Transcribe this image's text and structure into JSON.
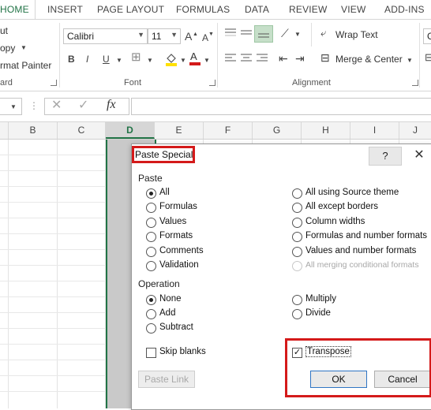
{
  "ribbon": {
    "tabs": [
      "HOME",
      "INSERT",
      "PAGE LAYOUT",
      "FORMULAS",
      "DATA",
      "REVIEW",
      "VIEW",
      "ADD-INS"
    ],
    "clipboard": {
      "cut": "ut",
      "copy": "opy",
      "format_painter": "rmat Painter",
      "label": "ard"
    },
    "font": {
      "name": "Calibri",
      "size": "11",
      "label": "Font",
      "grow": "A",
      "shrink": "A",
      "bold": "B",
      "italic": "I",
      "underline": "U"
    },
    "alignment": {
      "wrap_text": "Wrap Text",
      "merge_center": "Merge & Center",
      "label": "Alignment"
    },
    "number_format_partial": "G"
  },
  "formula_bar": {
    "fx": "fx",
    "cancel": "✕",
    "enter": "✓"
  },
  "columns": [
    "B",
    "C",
    "D",
    "E",
    "F",
    "G",
    "H",
    "I",
    "J"
  ],
  "selected_column": "D",
  "dialog": {
    "title": "Paste Special",
    "help": "?",
    "close": "✕",
    "paste_section": "Paste",
    "paste_left": [
      {
        "label": "All",
        "selected": true
      },
      {
        "label": "Formulas",
        "selected": false
      },
      {
        "label": "Values",
        "selected": false
      },
      {
        "label": "Formats",
        "selected": false
      },
      {
        "label": "Comments",
        "selected": false
      },
      {
        "label": "Validation",
        "selected": false
      }
    ],
    "paste_right": [
      {
        "label": "All using Source theme",
        "disabled": false
      },
      {
        "label": "All except borders",
        "disabled": false
      },
      {
        "label": "Column widths",
        "disabled": false
      },
      {
        "label": "Formulas and number formats",
        "disabled": false
      },
      {
        "label": "Values and number formats",
        "disabled": false
      },
      {
        "label": "All merging conditional formats",
        "disabled": true
      }
    ],
    "operation_section": "Operation",
    "operation_left": [
      {
        "label": "None",
        "selected": true
      },
      {
        "label": "Add",
        "selected": false
      },
      {
        "label": "Subtract",
        "selected": false
      }
    ],
    "operation_right": [
      {
        "label": "Multiply",
        "selected": false
      },
      {
        "label": "Divide",
        "selected": false
      }
    ],
    "skip_blanks": {
      "label": "Skip blanks",
      "checked": false
    },
    "transpose": {
      "label": "Transpose",
      "checked": true
    },
    "paste_link": "Paste Link",
    "ok": "OK",
    "cancel": "Cancel"
  },
  "colors": {
    "excel_green": "#217346",
    "highlight_red": "#d41a1a"
  }
}
